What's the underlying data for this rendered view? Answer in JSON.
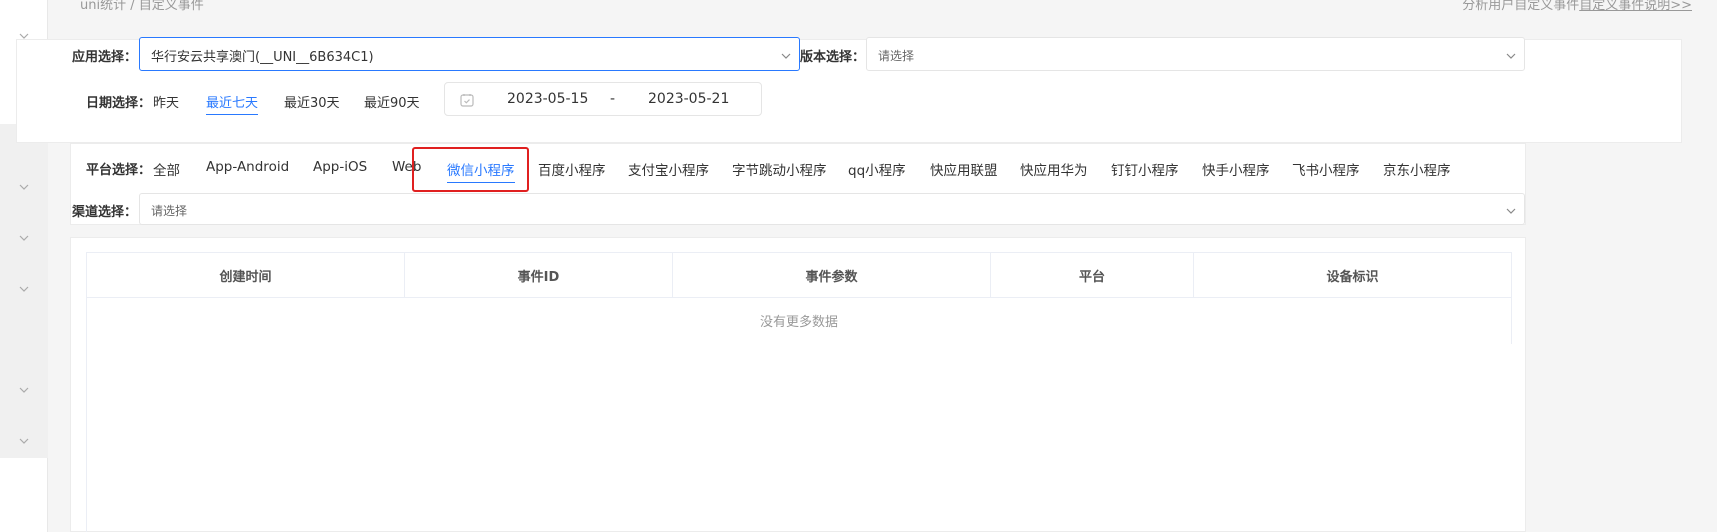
{
  "breadcrumb": {
    "path": "uni统计 / 自定义事件"
  },
  "hint": {
    "prefix": "分析用户自定义事件",
    "link": "自定义事件说明>>"
  },
  "filters": {
    "app_label": "应用选择：",
    "app_value": "华行安云共享澳门(__UNI__6B634C1)",
    "version_label": "版本选择：",
    "version_placeholder": "请选择",
    "date_label": "日期选择：",
    "date_options": [
      "昨天",
      "最近七天",
      "最近30天",
      "最近90天"
    ],
    "date_active": "最近七天",
    "date_start": "2023-05-15",
    "date_sep": "-",
    "date_end": "2023-05-21"
  },
  "platform": {
    "label": "平台选择：",
    "tabs": [
      "全部",
      "App-Android",
      "App-iOS",
      "Web",
      "微信小程序",
      "百度小程序",
      "支付宝小程序",
      "字节跳动小程序",
      "qq小程序",
      "快应用联盟",
      "快应用华为",
      "钉钉小程序",
      "快手小程序",
      "飞书小程序",
      "京东小程序"
    ],
    "active": "微信小程序",
    "channel_label": "渠道选择：",
    "channel_placeholder": "请选择"
  },
  "table": {
    "columns": [
      "创建时间",
      "事件ID",
      "事件参数",
      "平台",
      "设备标识"
    ],
    "empty_text": "没有更多数据"
  },
  "colors": {
    "accent": "#2979ff",
    "highlight_box": "#e02020"
  },
  "icons": [
    "chevron-down-icon",
    "chevron-up-icon",
    "calendar-icon"
  ]
}
